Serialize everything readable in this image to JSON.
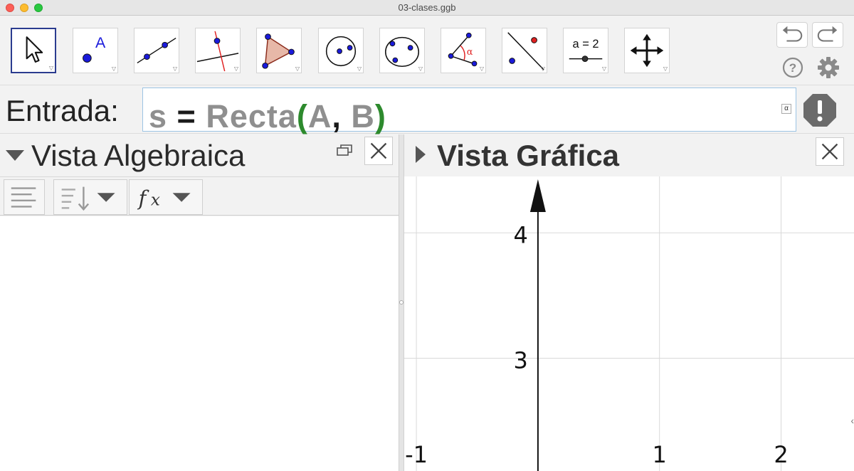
{
  "window": {
    "title": "03-clases.ggb"
  },
  "toolbar": {
    "tools": [
      {
        "name": "move-tool",
        "icon": "cursor-arrow-icon",
        "selected": true
      },
      {
        "name": "point-tool",
        "icon": "point-a-icon",
        "point_label": "A"
      },
      {
        "name": "line-tool",
        "icon": "line-through-points-icon"
      },
      {
        "name": "perpendicular-line-tool",
        "icon": "perpendicular-line-icon"
      },
      {
        "name": "polygon-tool",
        "icon": "polygon-icon"
      },
      {
        "name": "circle-center-point-tool",
        "icon": "circle-center-icon"
      },
      {
        "name": "circle-three-points-tool",
        "icon": "circle-three-points-icon"
      },
      {
        "name": "angle-tool",
        "icon": "angle-icon",
        "angle_symbol": "α"
      },
      {
        "name": "reflect-tool",
        "icon": "reflect-about-line-icon"
      },
      {
        "name": "slider-tool",
        "icon": "slider-icon",
        "slider_label": "a = 2"
      },
      {
        "name": "move-graphics-view-tool",
        "icon": "move-cross-icon"
      }
    ],
    "undo_icon": "undo-icon",
    "redo_icon": "redo-icon",
    "help_icon": "help-icon",
    "settings_icon": "gear-icon"
  },
  "input_bar": {
    "label": "Entrada:",
    "value_parts": {
      "var": "s",
      "eq": " = ",
      "fn": "Recta",
      "open": "(",
      "arg1": "A",
      "comma": ", ",
      "arg2": "B",
      "close": ")"
    },
    "symbol_button": "α",
    "warning_icon": "exclamation-stop-icon"
  },
  "algebra_view": {
    "title": "Vista Algebraica",
    "buttons": [
      {
        "name": "algebra-description-button",
        "icon": "lines-icon"
      },
      {
        "name": "algebra-sort-button",
        "icon": "sort-icon"
      },
      {
        "name": "algebra-fx-button",
        "icon": "fx-icon"
      }
    ]
  },
  "graphics_view": {
    "title": "Vista Gráfica"
  },
  "chart_data": {
    "type": "scatter",
    "title": "",
    "xlabel": "",
    "ylabel": "",
    "x_ticks": [
      "-1",
      "1",
      "2"
    ],
    "y_ticks": [
      "4",
      "3"
    ],
    "xlim": [
      -1.1,
      2.6
    ],
    "ylim": [
      2.1,
      4.45
    ],
    "grid": true,
    "series": []
  },
  "colors": {
    "selected_tool_border": "#2b3c8f",
    "point_blue": "#1a1adb",
    "paren_green": "#2d8a2d",
    "input_grey": "#8f8f8f"
  }
}
